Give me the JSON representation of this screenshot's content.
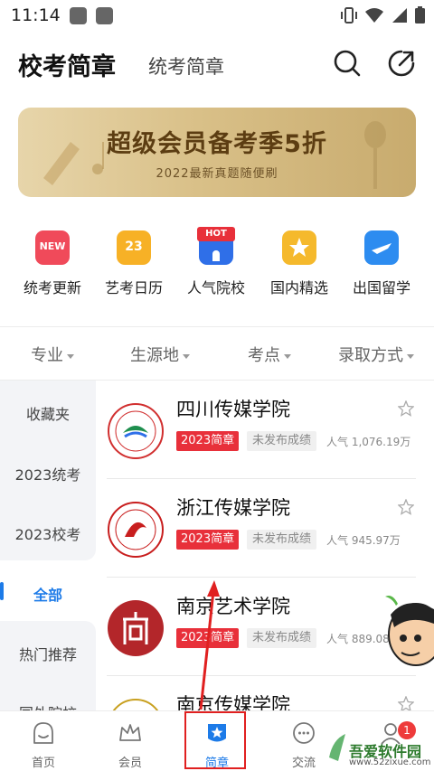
{
  "status": {
    "time": "11:14"
  },
  "header": {
    "title": "校考简章",
    "subtitle": "统考简章"
  },
  "banner": {
    "title": "超级会员备考季5折",
    "subtitle": "2022最新真题随便刷"
  },
  "quick_nav": [
    {
      "label": "统考更新",
      "badge": "NEW",
      "icon": "new-icon",
      "color": "#f04a5a"
    },
    {
      "label": "艺考日历",
      "badge": "23",
      "icon": "calendar-icon",
      "color": "#f7b126"
    },
    {
      "label": "人气院校",
      "badge": "HOT",
      "icon": "hot-school-icon",
      "color": "#2f6fe8"
    },
    {
      "label": "国内精选",
      "badge": "",
      "icon": "crown-star-icon",
      "color": "#f5b92c"
    },
    {
      "label": "出国留学",
      "badge": "",
      "icon": "airplane-icon",
      "color": "#2d8cf0"
    }
  ],
  "filters": [
    {
      "label": "专业"
    },
    {
      "label": "生源地"
    },
    {
      "label": "考点"
    },
    {
      "label": "录取方式"
    }
  ],
  "sidebar": [
    {
      "label": "收藏夹"
    },
    {
      "label": "2023统考"
    },
    {
      "label": "2023校考"
    },
    {
      "label": "全部",
      "active": true
    },
    {
      "label": "热门推荐"
    },
    {
      "label": "国外院校"
    }
  ],
  "schools": [
    {
      "name": "四川传媒学院",
      "tag": "2023简章",
      "status": "未发布成绩",
      "popularity": "人气 1,076.19万",
      "logo_color": "#d12f2f"
    },
    {
      "name": "浙江传媒学院",
      "tag": "2023简章",
      "status": "未发布成绩",
      "popularity": "人气 945.97万",
      "logo_color": "#c81e1e"
    },
    {
      "name": "南京艺术学院",
      "tag": "2023简章",
      "status": "未发布成绩",
      "popularity": "人气 889.08万",
      "logo_color": "#b3262a"
    },
    {
      "name": "南京传媒学院",
      "tag": "",
      "status": "",
      "popularity": "",
      "logo_color": "#c8a020"
    }
  ],
  "tabbar": [
    {
      "label": "首页",
      "icon": "home-face-icon"
    },
    {
      "label": "会员",
      "icon": "crown-icon"
    },
    {
      "label": "简章",
      "icon": "brochure-star-icon",
      "active": true
    },
    {
      "label": "交流",
      "icon": "chat-icon"
    },
    {
      "label": "",
      "icon": "profile-icon",
      "badge": "1"
    }
  ],
  "watermark": {
    "name": "吾爱软件园",
    "url": "www.52zixue.com"
  },
  "colors": {
    "accent": "#1d7be8",
    "tag_red": "#e8303a",
    "annotation_red": "#e02020"
  }
}
